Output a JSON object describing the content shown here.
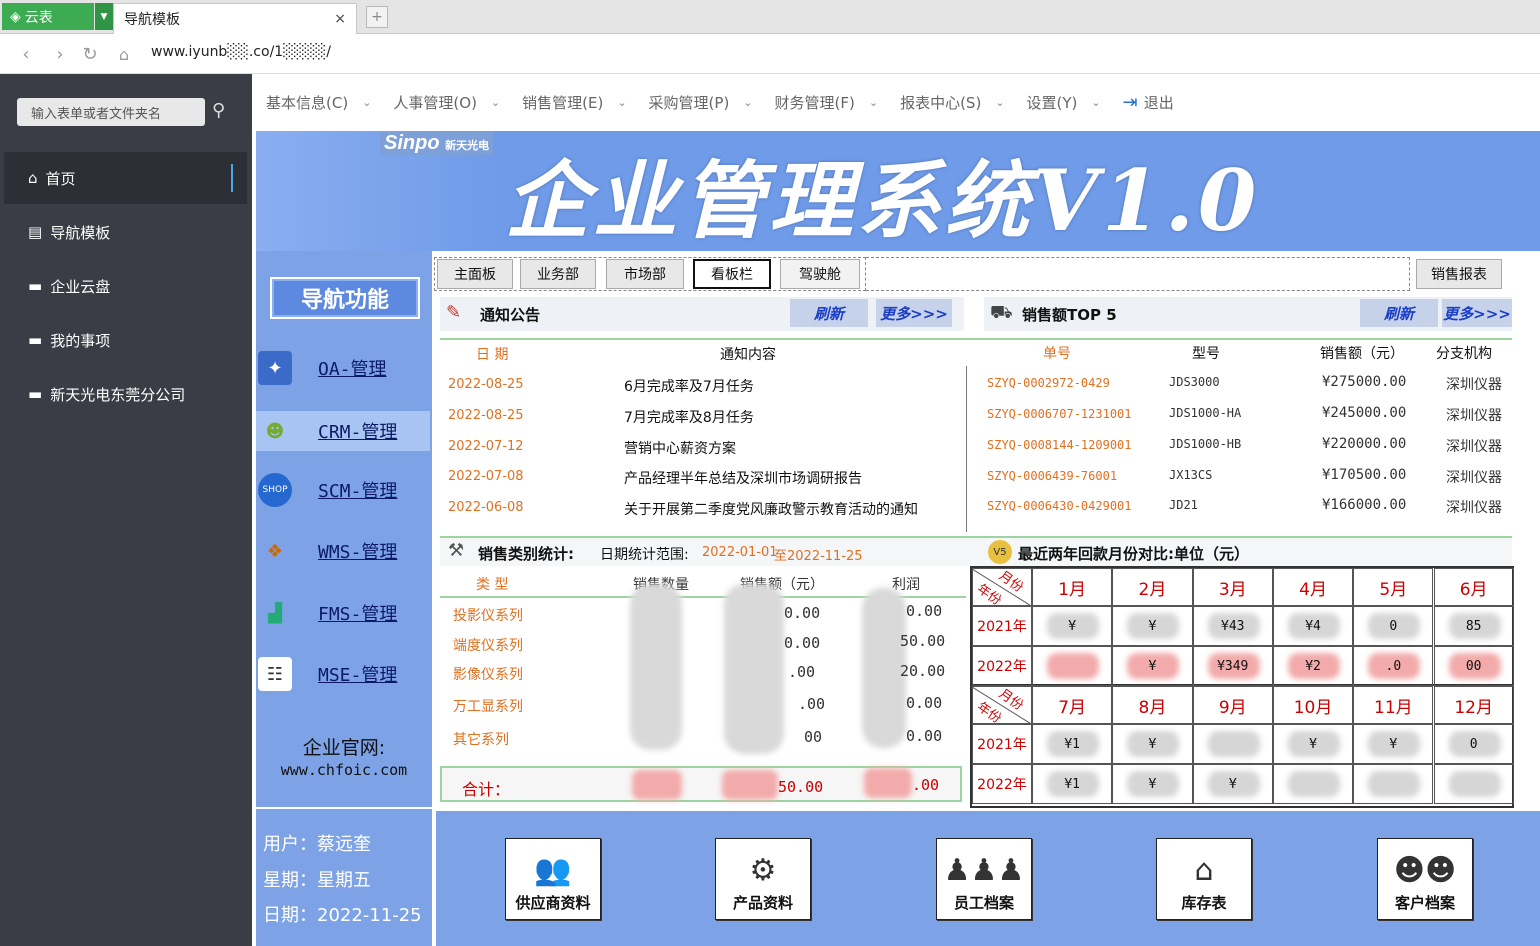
{
  "browser": {
    "app_name": "云表",
    "tab_title": "导航模板",
    "tab_close": "×",
    "new_tab": "+",
    "url": "www.iyunb░░.co/1░░░░/"
  },
  "sidebar": {
    "search_placeholder": "输入表单或者文件夹名",
    "items": [
      {
        "label": "首页",
        "icon": "home-icon"
      },
      {
        "label": "导航模板",
        "icon": "document-icon"
      },
      {
        "label": "企业云盘",
        "icon": "folder-icon"
      },
      {
        "label": "我的事项",
        "icon": "folder-icon"
      },
      {
        "label": "新天光电东莞分公司",
        "icon": "folder-icon"
      }
    ]
  },
  "topmenu": {
    "items": [
      "基本信息(C)",
      "人事管理(O)",
      "销售管理(E)",
      "采购管理(P)",
      "财务管理(F)",
      "报表中心(S)",
      "设置(Y)"
    ],
    "logout": "退出"
  },
  "banner": {
    "logo": "Sinpo",
    "logo_sub": "新天光电",
    "title": "企业管理系统V1.0"
  },
  "nav": {
    "title": "导航功能",
    "items": [
      {
        "label": "OA-管理",
        "icon": "oa-icon"
      },
      {
        "label": "CRM-管理",
        "icon": "crm-icon"
      },
      {
        "label": "SCM-管理",
        "icon": "scm-icon"
      },
      {
        "label": "WMS-管理",
        "icon": "wms-icon"
      },
      {
        "label": "FMS-管理",
        "icon": "fms-icon"
      },
      {
        "label": "MSE-管理",
        "icon": "mse-icon"
      }
    ],
    "website_label": "企业官网:",
    "website": "www.chfoic.com"
  },
  "user": {
    "user_line": "用户：蔡远奎",
    "weekday_line": "星期：星期五",
    "date_line": "日期：2022-11-25"
  },
  "tabs": [
    "主面板",
    "业务部",
    "市场部",
    "看板栏",
    "驾驶舱"
  ],
  "tab_right": "销售报表",
  "notice": {
    "title": "通知公告",
    "refresh": "刷新",
    "more": "更多>>>",
    "col_date": "日 期",
    "col_content": "通知内容",
    "rows": [
      {
        "date": "2022-08-25",
        "content": "6月完成率及7月任务"
      },
      {
        "date": "2022-08-25",
        "content": "7月完成率及8月任务"
      },
      {
        "date": "2022-07-12",
        "content": "营销中心薪资方案"
      },
      {
        "date": "2022-07-08",
        "content": "产品经理半年总结及深圳市场调研报告"
      },
      {
        "date": "2022-06-08",
        "content": "关于开展第二季度党风廉政警示教育活动的通知"
      }
    ]
  },
  "top5": {
    "title": "销售额TOP 5",
    "refresh": "刷新",
    "more": "更多>>>",
    "cols": [
      "单号",
      "型号",
      "销售额（元）",
      "分支机构"
    ],
    "rows": [
      {
        "no": "SZYQ-0002972-0429",
        "model": "JDS3000",
        "amount": "¥275000.00",
        "branch": "深圳仪器"
      },
      {
        "no": "SZYQ-0006707-1231001",
        "model": "JDS1000-HA",
        "amount": "¥245000.00",
        "branch": "深圳仪器"
      },
      {
        "no": "SZYQ-0008144-1209001",
        "model": "JDS1000-HB",
        "amount": "¥220000.00",
        "branch": "深圳仪器"
      },
      {
        "no": "SZYQ-0006439-76001",
        "model": "JX13CS",
        "amount": "¥170500.00",
        "branch": "深圳仪器"
      },
      {
        "no": "SZYQ-0006430-0429001",
        "model": "JD21",
        "amount": "¥166000.00",
        "branch": "深圳仪器"
      }
    ]
  },
  "category": {
    "title": "销售类别统计:",
    "range_label": "日期统计范围:",
    "range_from": "2022-01-01",
    "range_to": "至2022-11-25",
    "cols": [
      "类 型",
      "销售数量",
      "销售额（元）",
      "利润"
    ],
    "rows": [
      {
        "type": "投影仪系列",
        "amount_tail": "0.00",
        "profit_tail": "0.00"
      },
      {
        "type": "端度仪系列",
        "amount_tail": "0.00",
        "profit_tail": "50.00"
      },
      {
        "type": "影像仪系列",
        "amount_tail": ".00",
        "profit_tail": "20.00"
      },
      {
        "type": "万工显系列",
        "amount_tail": ".00",
        "profit_tail": "0.00"
      },
      {
        "type": "其它系列",
        "amount_tail": "00",
        "profit_tail": "0.00"
      }
    ],
    "total_label": "合计：",
    "total_amount_tail": "50.00",
    "total_profit_tail": ".00"
  },
  "monthly": {
    "title": "最近两年回款月份对比:单位（元）",
    "corner_top": "月份",
    "corner_bottom": "年份",
    "months1": [
      "1月",
      "2月",
      "3月",
      "4月",
      "5月",
      "6月"
    ],
    "months2": [
      "7月",
      "8月",
      "9月",
      "10月",
      "11月",
      "12月"
    ],
    "years": [
      "2021年",
      "2022年"
    ],
    "h1_2021": [
      "¥",
      "¥",
      "¥43",
      "¥4",
      "0",
      "85"
    ],
    "h1_2022": [
      "",
      "¥",
      "¥349",
      "¥2",
      ".0",
      "00"
    ],
    "h2_2021": [
      "¥1",
      "¥",
      "",
      "¥",
      "¥",
      "0"
    ],
    "h2_2022": [
      "¥1",
      "¥",
      "¥",
      "",
      "",
      ""
    ]
  },
  "bottom": {
    "items": [
      "供应商资料",
      "产品资料",
      "员工档案",
      "库存表",
      "客户档案"
    ]
  },
  "colors": {
    "accent_blue": "#6f9be8",
    "panel_blue": "#7da3e6",
    "red_text": "#c00000",
    "orange_text": "#e07020",
    "sidebar_dark": "#3a3d46"
  }
}
